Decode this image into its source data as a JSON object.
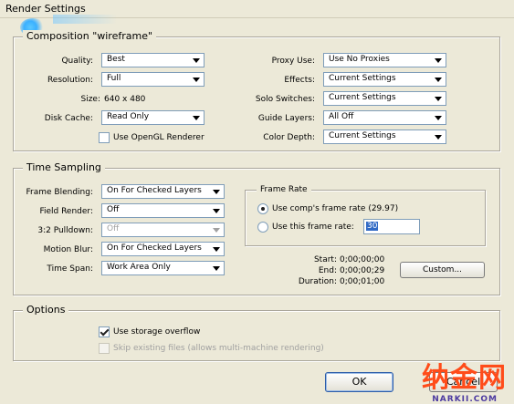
{
  "window": {
    "title": "Render Settings"
  },
  "composition": {
    "legend": "Composition \"wireframe\"",
    "quality": {
      "label": "Quality:",
      "value": "Best"
    },
    "resolution": {
      "label": "Resolution:",
      "value": "Full"
    },
    "size": {
      "label": "Size:",
      "value": "640 x 480"
    },
    "disk_cache": {
      "label": "Disk Cache:",
      "value": "Read Only"
    },
    "opengl": {
      "label": "Use OpenGL Renderer",
      "checked": false
    },
    "proxy_use": {
      "label": "Proxy Use:",
      "value": "Use No Proxies"
    },
    "effects": {
      "label": "Effects:",
      "value": "Current Settings"
    },
    "solo_switches": {
      "label": "Solo Switches:",
      "value": "Current Settings"
    },
    "guide_layers": {
      "label": "Guide Layers:",
      "value": "All Off"
    },
    "color_depth": {
      "label": "Color Depth:",
      "value": "Current Settings"
    }
  },
  "time_sampling": {
    "legend": "Time Sampling",
    "frame_blending": {
      "label": "Frame Blending:",
      "value": "On For Checked Layers"
    },
    "field_render": {
      "label": "Field Render:",
      "value": "Off"
    },
    "pulldown": {
      "label": "3:2 Pulldown:",
      "value": "Off",
      "disabled": true
    },
    "motion_blur": {
      "label": "Motion Blur:",
      "value": "On For Checked Layers"
    },
    "time_span": {
      "label": "Time Span:",
      "value": "Work Area Only"
    },
    "frame_rate": {
      "legend": "Frame Rate",
      "comp_rate_label": "Use comp's frame rate (29.97)",
      "this_rate_label": "Use this frame rate:",
      "this_rate_value": "30",
      "selected": "comp"
    },
    "start": {
      "label": "Start:",
      "value": "0;00;00;00"
    },
    "end": {
      "label": "End:",
      "value": "0;00;00;29"
    },
    "duration": {
      "label": "Duration:",
      "value": "0;00;01;00"
    },
    "custom_button": "Custom..."
  },
  "options": {
    "legend": "Options",
    "storage_overflow": {
      "label": "Use storage overflow",
      "checked": true
    },
    "skip_existing": {
      "label": "Skip existing files (allows multi-machine rendering)",
      "checked": false,
      "disabled": true
    }
  },
  "buttons": {
    "ok": "OK",
    "cancel": "Cancel"
  },
  "watermark": {
    "logo": "纳金网",
    "url": "NARKII.COM"
  }
}
